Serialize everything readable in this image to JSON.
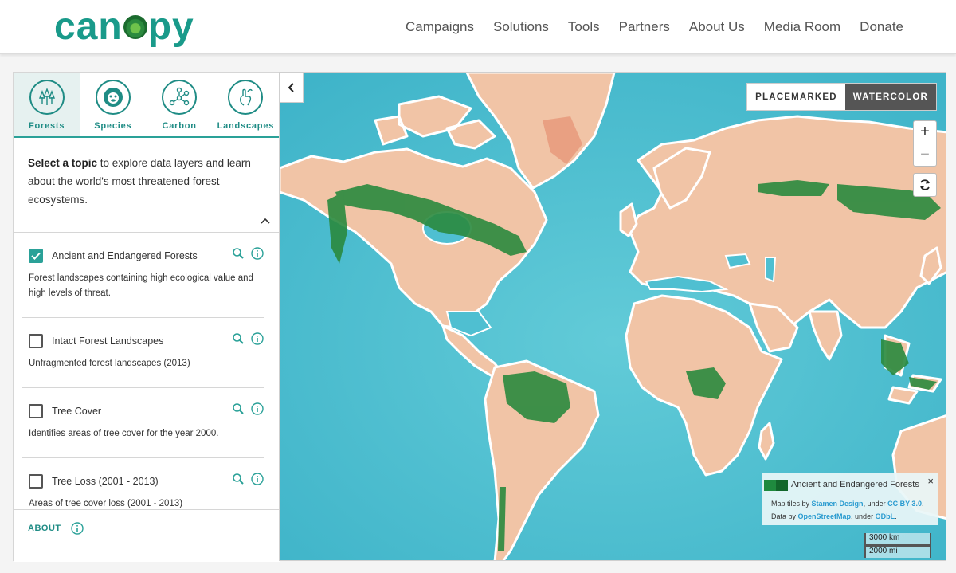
{
  "brand": {
    "logo_text_a": "can",
    "logo_text_b": "py"
  },
  "nav": [
    "Campaigns",
    "Solutions",
    "Tools",
    "Partners",
    "About Us",
    "Media Room",
    "Donate"
  ],
  "tabs": [
    {
      "label": "Forests",
      "icon": "forest-icon"
    },
    {
      "label": "Species",
      "icon": "species-icon"
    },
    {
      "label": "Carbon",
      "icon": "carbon-icon"
    },
    {
      "label": "Landscapes",
      "icon": "landscapes-icon"
    }
  ],
  "intro": {
    "bold": "Select a topic",
    "rest": " to explore data layers and learn about the world's most threatened forest ecosystems."
  },
  "layers": [
    {
      "title": "Ancient and Endangered Forests",
      "checked": true,
      "desc": "Forest landscapes containing high ecological value and high levels of threat."
    },
    {
      "title": "Intact Forest Landscapes",
      "checked": false,
      "desc": "Unfragmented forest landscapes (2013)"
    },
    {
      "title": "Tree Cover",
      "checked": false,
      "desc": "Identifies areas of tree cover for the year 2000."
    },
    {
      "title": "Tree Loss (2001 - 2013)",
      "checked": false,
      "desc": "Areas of tree cover loss (2001 - 2013)"
    }
  ],
  "about_label": "ABOUT",
  "basemap": {
    "option_a": "PLACEMARKED",
    "option_b": "WATERCOLOR",
    "selected": "WATERCOLOR"
  },
  "zoom": {
    "in": "+",
    "out": "−"
  },
  "legend": {
    "title": "Ancient and Endangered Forests",
    "colors": [
      "#1f8a3e",
      "#12672b"
    ],
    "close": "×",
    "attribution": {
      "t1": "Map tiles by ",
      "l1": "Stamen Design",
      "t2": ", under ",
      "l2": "CC BY 3.0",
      "t3": ". Data by ",
      "l3": "OpenStreetMap",
      "t4": ", under ",
      "l4": "ODbL",
      "t5": "."
    }
  },
  "scale": {
    "km": "3000 km",
    "mi": "2000 mi"
  },
  "colors": {
    "accent": "#2aa198",
    "ocean": "#5cc4d4",
    "land": "#f1c5a8",
    "forest": "#2a8a3e"
  }
}
